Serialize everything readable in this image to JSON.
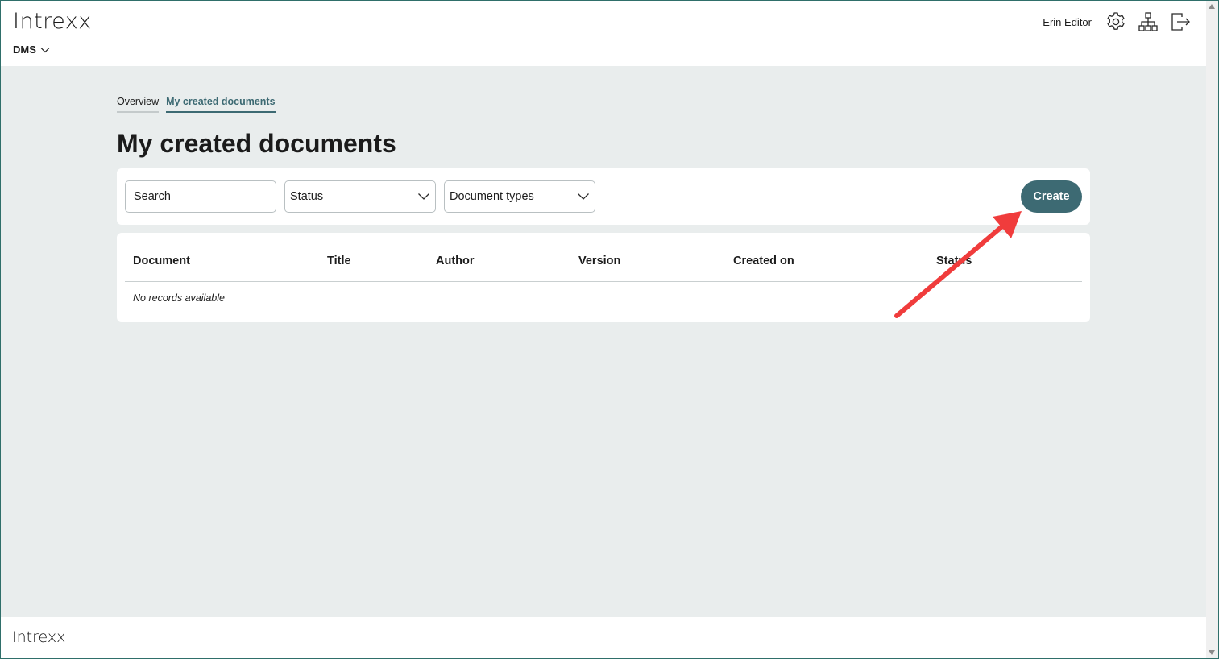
{
  "header": {
    "logo": "Intrexx",
    "app_name": "DMS",
    "user_name": "Erin Editor",
    "icons": [
      "gear-icon",
      "sitemap-icon",
      "logout-icon"
    ]
  },
  "tabs": [
    {
      "label": "Overview",
      "active": false
    },
    {
      "label": "My created documents",
      "active": true
    }
  ],
  "page_title": "My created documents",
  "filters": {
    "search_placeholder": "Search",
    "status_label": "Status",
    "document_types_label": "Document types",
    "create_label": "Create"
  },
  "table": {
    "columns": [
      "Document",
      "Title",
      "Author",
      "Version",
      "Created on",
      "Status"
    ],
    "empty_text": "No records available"
  },
  "footer": {
    "logo": "Intrexx"
  },
  "colors": {
    "accent": "#3d6a73",
    "background": "#e9eded",
    "annotation_arrow": "#f03c3c"
  }
}
